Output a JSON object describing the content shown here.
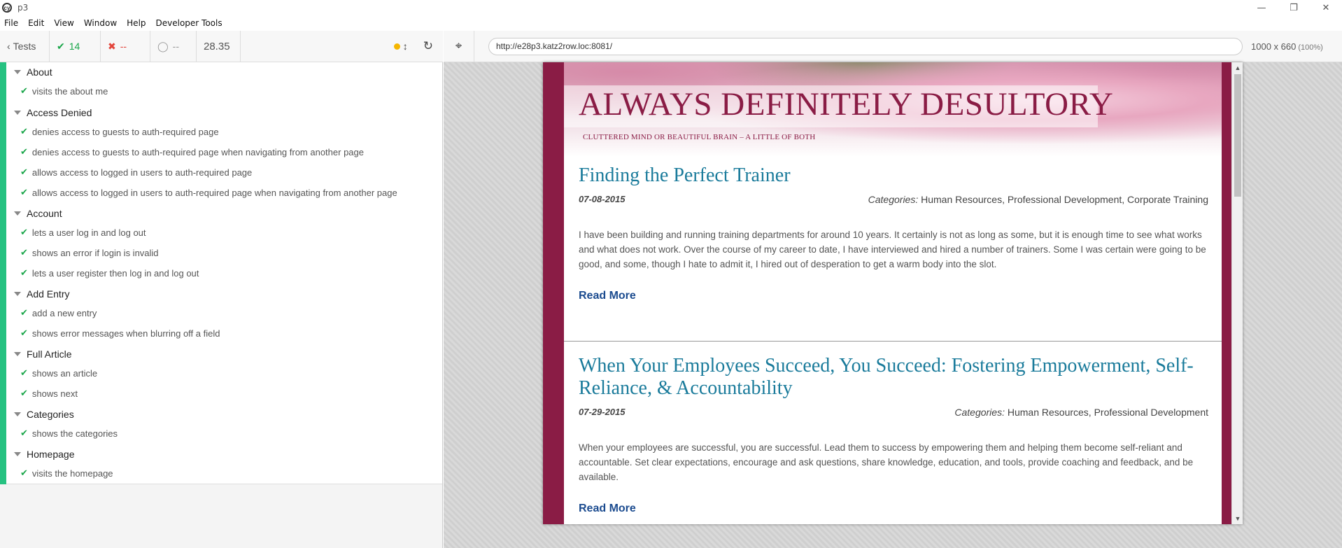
{
  "window": {
    "title": "p3",
    "minimize": "—",
    "restore": "❐",
    "close": "✕"
  },
  "menu": [
    "File",
    "Edit",
    "View",
    "Window",
    "Help",
    "Developer Tools"
  ],
  "runner": {
    "back_label": "Tests",
    "passed": "14",
    "failed": "--",
    "pending": "--",
    "duration": "28.35"
  },
  "suites": [
    {
      "title": "About",
      "tests": [
        "visits the about me"
      ]
    },
    {
      "title": "Access Denied",
      "tests": [
        "denies access to guests to auth-required page",
        "denies access to guests to auth-required page when navigating from another page",
        "allows access to logged in users to auth-required page",
        "allows access to logged in users to auth-required page when navigating from another page"
      ]
    },
    {
      "title": "Account",
      "tests": [
        "lets a user log in and log out",
        "shows an error if login is invalid",
        "lets a user register then log in and log out"
      ]
    },
    {
      "title": "Add Entry",
      "tests": [
        "add a new entry",
        "shows error messages when blurring off a field"
      ]
    },
    {
      "title": "Full Article",
      "tests": [
        "shows an article",
        "shows next"
      ]
    },
    {
      "title": "Categories",
      "tests": [
        "shows the categories"
      ]
    },
    {
      "title": "Homepage",
      "tests": [
        "visits the homepage"
      ]
    }
  ],
  "aut": {
    "url": "http://e28p3.katz2row.loc:8081/",
    "viewport": "1000 x 660",
    "zoom": "(100%)"
  },
  "site": {
    "title": "ALWAYS DEFINITELY DESULTORY",
    "tagline": "CLUTTERED MIND OR BEAUTIFUL BRAIN – A LITTLE OF BOTH",
    "posts": [
      {
        "title": "Finding the Perfect Trainer",
        "date": "07-08-2015",
        "categories_label": "Categories:",
        "categories": "Human Resources, Professional Development, Corporate Training",
        "body": "I have been building and running training departments for around 10 years. It certainly is not as long as some, but it is enough time to see what works and what does not work. Over the course of my career to date, I have interviewed and hired a number of trainers. Some I was certain were going to be good, and some, though I hate to admit it, I hired out of desperation to get a warm body into the slot.",
        "read_more": "Read More"
      },
      {
        "title": "When Your Employees Succeed, You Succeed: Fostering Empowerment, Self-Reliance, & Accountability",
        "date": "07-29-2015",
        "categories_label": "Categories:",
        "categories": "Human Resources, Professional Development",
        "body": "When your employees are successful, you are successful. Lead them to success by empowering them and helping them become self-reliant and accountable. Set clear expectations, encourage and ask questions, share knowledge, education, and tools, provide coaching and feedback, and be available.",
        "read_more": "Read More"
      }
    ]
  }
}
